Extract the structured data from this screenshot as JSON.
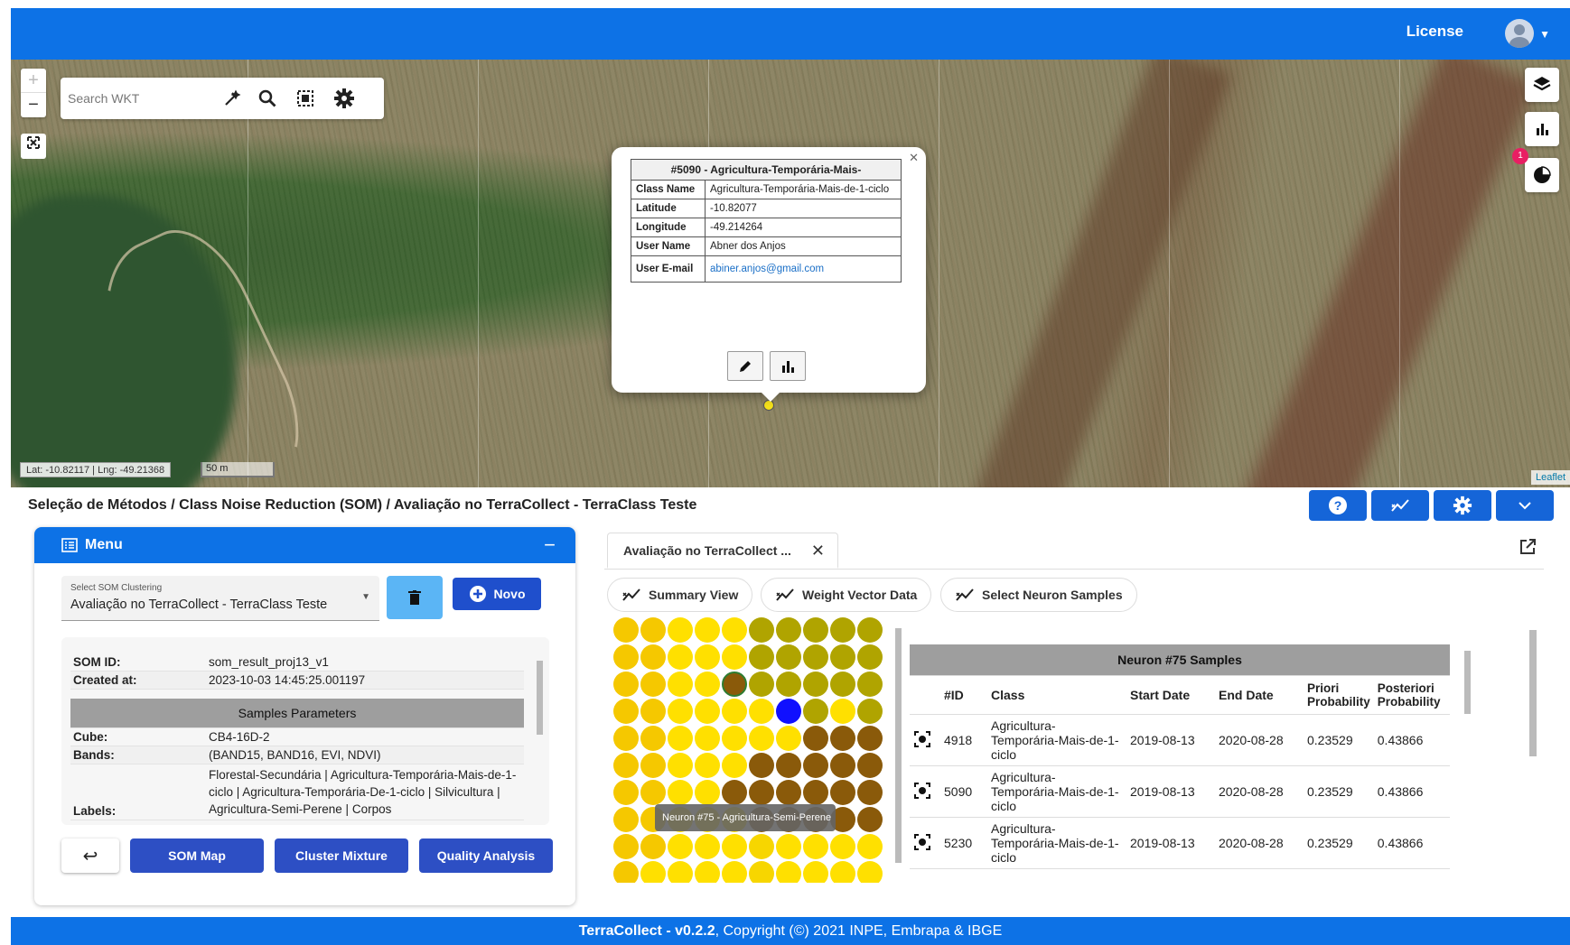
{
  "header": {
    "license": "License"
  },
  "search": {
    "placeholder": "Search WKT"
  },
  "map": {
    "coords": "Lat: -10.82117 | Lng: -49.21368",
    "scale": "50 m",
    "attribution": "Leaflet",
    "badge_count": "1"
  },
  "popup": {
    "title": "#5090 - Agricultura-Temporária-Mais-",
    "rows": [
      {
        "k": "Class Name",
        "v": "Agricultura-Temporária-Mais-de-1-ciclo"
      },
      {
        "k": "Latitude",
        "v": "-10.82077"
      },
      {
        "k": "Longitude",
        "v": "-49.214264"
      },
      {
        "k": "User Name",
        "v": "Abner dos Anjos"
      },
      {
        "k": "User E-mail",
        "v": "abiner.anjos@gmail.com"
      }
    ]
  },
  "breadcrumb": "Seleção de Métodos / Class Noise Reduction (SOM) / Avaliação no TerraCollect - TerraClass Teste",
  "menu": {
    "title": "Menu",
    "select_label": "Select SOM Clustering",
    "select_value": "Avaliação no TerraCollect - TerraClass Teste",
    "novo": "Novo",
    "info": {
      "som_id_k": "SOM ID:",
      "som_id_v": "som_result_proj13_v1",
      "created_k": "Created at:",
      "created_v": "2023-10-03 14:45:25.001197",
      "params_title": "Samples Parameters",
      "cube_k": "Cube:",
      "cube_v": "CB4-16D-2",
      "bands_k": "Bands:",
      "bands_v": "(BAND15, BAND16, EVI, NDVI)",
      "labels_k": "Labels:",
      "labels_v": "Florestal-Secundária | Agricultura-Temporária-Mais-de-1-ciclo | Agricultura-Temporária-De-1-ciclo | Silvicultura | Agricultura-Semi-Perene | Corpos"
    },
    "buttons": {
      "som_map": "SOM Map",
      "cluster_mixture": "Cluster Mixture",
      "quality_analysis": "Quality Analysis"
    }
  },
  "tab": {
    "label": "Avaliação no TerraCollect ..."
  },
  "views": {
    "summary": "Summary View",
    "weight": "Weight Vector Data",
    "select_neuron": "Select Neuron Samples"
  },
  "neuron_tooltip": "Neuron #75 - Agricultura-Semi-Perene",
  "colors": {
    "c1": "#f5c800",
    "c2": "#ffe000",
    "c3": "#b0a400",
    "c4": "#8a5a0a",
    "c5": "#1010ff",
    "c6": "#f7d600"
  },
  "som_grid": [
    [
      "c1",
      "c1",
      "c2",
      "c2",
      "c2",
      "c3",
      "c3",
      "c3",
      "c3",
      "c3"
    ],
    [
      "c1",
      "c1",
      "c2",
      "c2",
      "c2",
      "c3",
      "c3",
      "c3",
      "c3",
      "c3"
    ],
    [
      "c1",
      "c1",
      "c2",
      "c2",
      "c4",
      "c3",
      "c3",
      "c3",
      "c3",
      "c3"
    ],
    [
      "c1",
      "c1",
      "c2",
      "c2",
      "c2",
      "c2",
      "c5",
      "c3",
      "c2",
      "c3"
    ],
    [
      "c1",
      "c1",
      "c2",
      "c2",
      "c2",
      "c2",
      "c2",
      "c4",
      "c4",
      "c4"
    ],
    [
      "c1",
      "c1",
      "c2",
      "c2",
      "c2",
      "c4",
      "c4",
      "c4",
      "c4",
      "c4"
    ],
    [
      "c1",
      "c1",
      "c2",
      "c2",
      "c4",
      "c4",
      "c4",
      "c4",
      "c4",
      "c4"
    ],
    [
      "c1",
      "c1",
      "c2",
      "c2",
      "c2",
      "c4",
      "c4",
      "c4",
      "c4",
      "c4"
    ],
    [
      "c1",
      "c1",
      "c2",
      "c2",
      "c2",
      "c6",
      "c2",
      "c2",
      "c2",
      "c2"
    ],
    [
      "c1",
      "c2",
      "c2",
      "c2",
      "c2",
      "c6",
      "c2",
      "c2",
      "c2",
      "c2"
    ]
  ],
  "samples": {
    "title": "Neuron #75 Samples",
    "cols": [
      "#ID",
      "Class",
      "Start Date",
      "End Date",
      "Priori Probability",
      "Posteriori Probability"
    ],
    "rows": [
      {
        "id": "4918",
        "cls": "Agricultura-Temporária-Mais-de-1-ciclo",
        "start": "2019-08-13",
        "end": "2020-08-28",
        "pri": "0.23529",
        "post": "0.43866"
      },
      {
        "id": "5090",
        "cls": "Agricultura-Temporária-Mais-de-1-ciclo",
        "start": "2019-08-13",
        "end": "2020-08-28",
        "pri": "0.23529",
        "post": "0.43866"
      },
      {
        "id": "5230",
        "cls": "Agricultura-Temporária-Mais-de-1-ciclo",
        "start": "2019-08-13",
        "end": "2020-08-28",
        "pri": "0.23529",
        "post": "0.43866"
      }
    ]
  },
  "footer": {
    "app": "TerraCollect - v0.2.2",
    "rest": ", Copyright (©) 2021 INPE, Embrapa & IBGE"
  }
}
